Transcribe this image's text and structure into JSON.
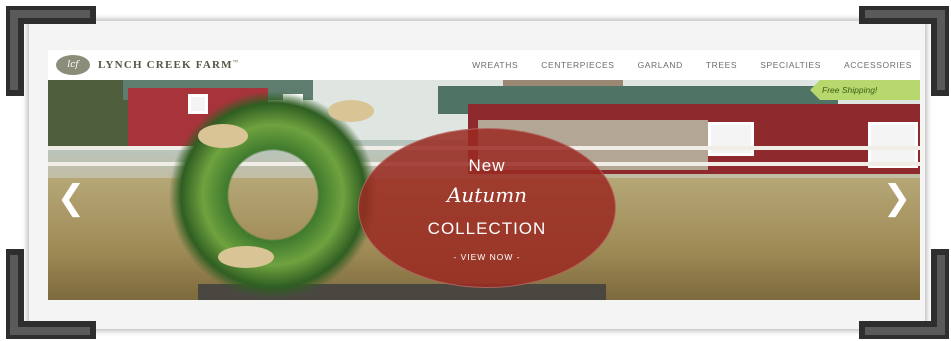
{
  "brand": {
    "badge": "lcf",
    "name": "LYNCH CREEK FARM",
    "tm": "™"
  },
  "nav": {
    "items": [
      "WREATHS",
      "CENTERPIECES",
      "GARLAND",
      "TREES",
      "SPECIALTIES",
      "ACCESSORIES"
    ]
  },
  "hero": {
    "promo": {
      "line1": "New",
      "line2": "Autumn",
      "line3": "COLLECTION",
      "cta": "- VIEW NOW -"
    },
    "shipping_banner": "Free Shipping!",
    "arrows": {
      "left": "❮",
      "right": "❯"
    }
  },
  "colors": {
    "promo_bg": "#9a2a22",
    "shipping_bg": "#b6d86c",
    "nav_text": "#6d6d6d"
  },
  "icons": [
    "chevron-left-icon",
    "chevron-right-icon",
    "logo-badge"
  ]
}
